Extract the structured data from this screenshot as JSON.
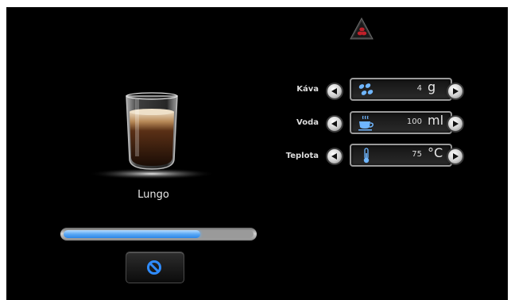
{
  "status": {
    "icon": "coffee-beans-warning-icon",
    "color": "#c0202a"
  },
  "drink": {
    "name": "Lungo"
  },
  "progress": {
    "fraction": 0.72,
    "color": "#5aa8f5"
  },
  "cancel": {
    "icon": "cancel-icon",
    "color": "#2f8cff"
  },
  "settings": [
    {
      "label": "Káva",
      "value": "4",
      "unit": "g",
      "icon": "coffee-beans-icon"
    },
    {
      "label": "Voda",
      "value": "100",
      "unit": "ml",
      "icon": "water-cup-icon"
    },
    {
      "label": "Teplota",
      "value": "75",
      "unit": "°C",
      "icon": "thermometer-icon"
    }
  ]
}
